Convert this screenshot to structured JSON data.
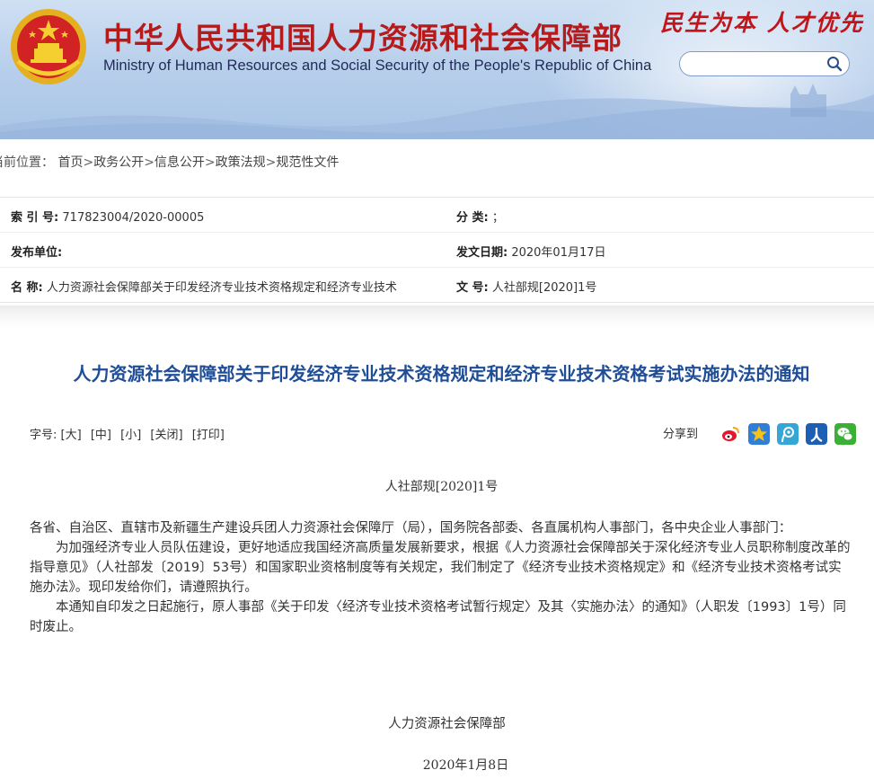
{
  "header": {
    "ministry_cn": "中华人民共和国人力资源和社会保障部",
    "ministry_en": "Ministry of Human Resources and Social Security of the People's Republic of China",
    "slogan": "民生为本 人才优先",
    "search": {
      "value": "",
      "placeholder": ""
    },
    "colors": {
      "title_red": "#b51b1b",
      "banner_blue": "#b9d0ec"
    }
  },
  "breadcrumb": {
    "lead": "当前位置：",
    "items": [
      "首页",
      "政务公开",
      "信息公开",
      "政策法规",
      "规范性文件"
    ],
    "separator": ">"
  },
  "info": {
    "index_label": "索 引 号:",
    "index_value": "717823004/2020-00005",
    "category_label": "分 类:",
    "category_value": "；",
    "publisher_label": "发布单位:",
    "publisher_value": "",
    "date_label": "发文日期:",
    "date_value": "2020年01月17日",
    "name_label": "名 称:",
    "name_value": "人力资源社会保障部关于印发经济专业技术资格规定和经济专业技术",
    "docno_label": "文 号:",
    "docno_value": "人社部规[2020]1号"
  },
  "article": {
    "title": "人力资源社会保障部关于印发经济专业技术资格规定和经济专业技术资格考试实施办法的通知",
    "toolbar": {
      "font_label": "字号:",
      "large": "[大]",
      "medium": "[中]",
      "small": "[小]",
      "close": "[关闭]",
      "print": "[打印]"
    },
    "share_label": "分享到",
    "share_icons": [
      "weibo-icon",
      "qzone-icon",
      "tencent-weibo-icon",
      "renren-icon",
      "wechat-icon"
    ],
    "doc_number": "人社部规[2020]1号",
    "addressee": "各省、自治区、直辖市及新疆生产建设兵团人力资源社会保障厅（局），国务院各部委、各直属机构人事部门，各中央企业人事部门：",
    "para1": "为加强经济专业人员队伍建设，更好地适应我国经济高质量发展新要求，根据《人力资源社会保障部关于深化经济专业人员职称制度改革的指导意见》（人社部发〔2019〕53号）和国家职业资格制度等有关规定，我们制定了《经济专业技术资格规定》和《经济专业技术资格考试实施办法》。现印发给你们，请遵照执行。",
    "para2": "本通知自印发之日起施行，原人事部《关于印发〈经济专业技术资格考试暂行规定〉及其〈实施办法〉的通知》（人职发〔1993〕1号）同时废止。",
    "signature_org": "人力资源社会保障部",
    "signature_date": "2020年1月8日"
  }
}
